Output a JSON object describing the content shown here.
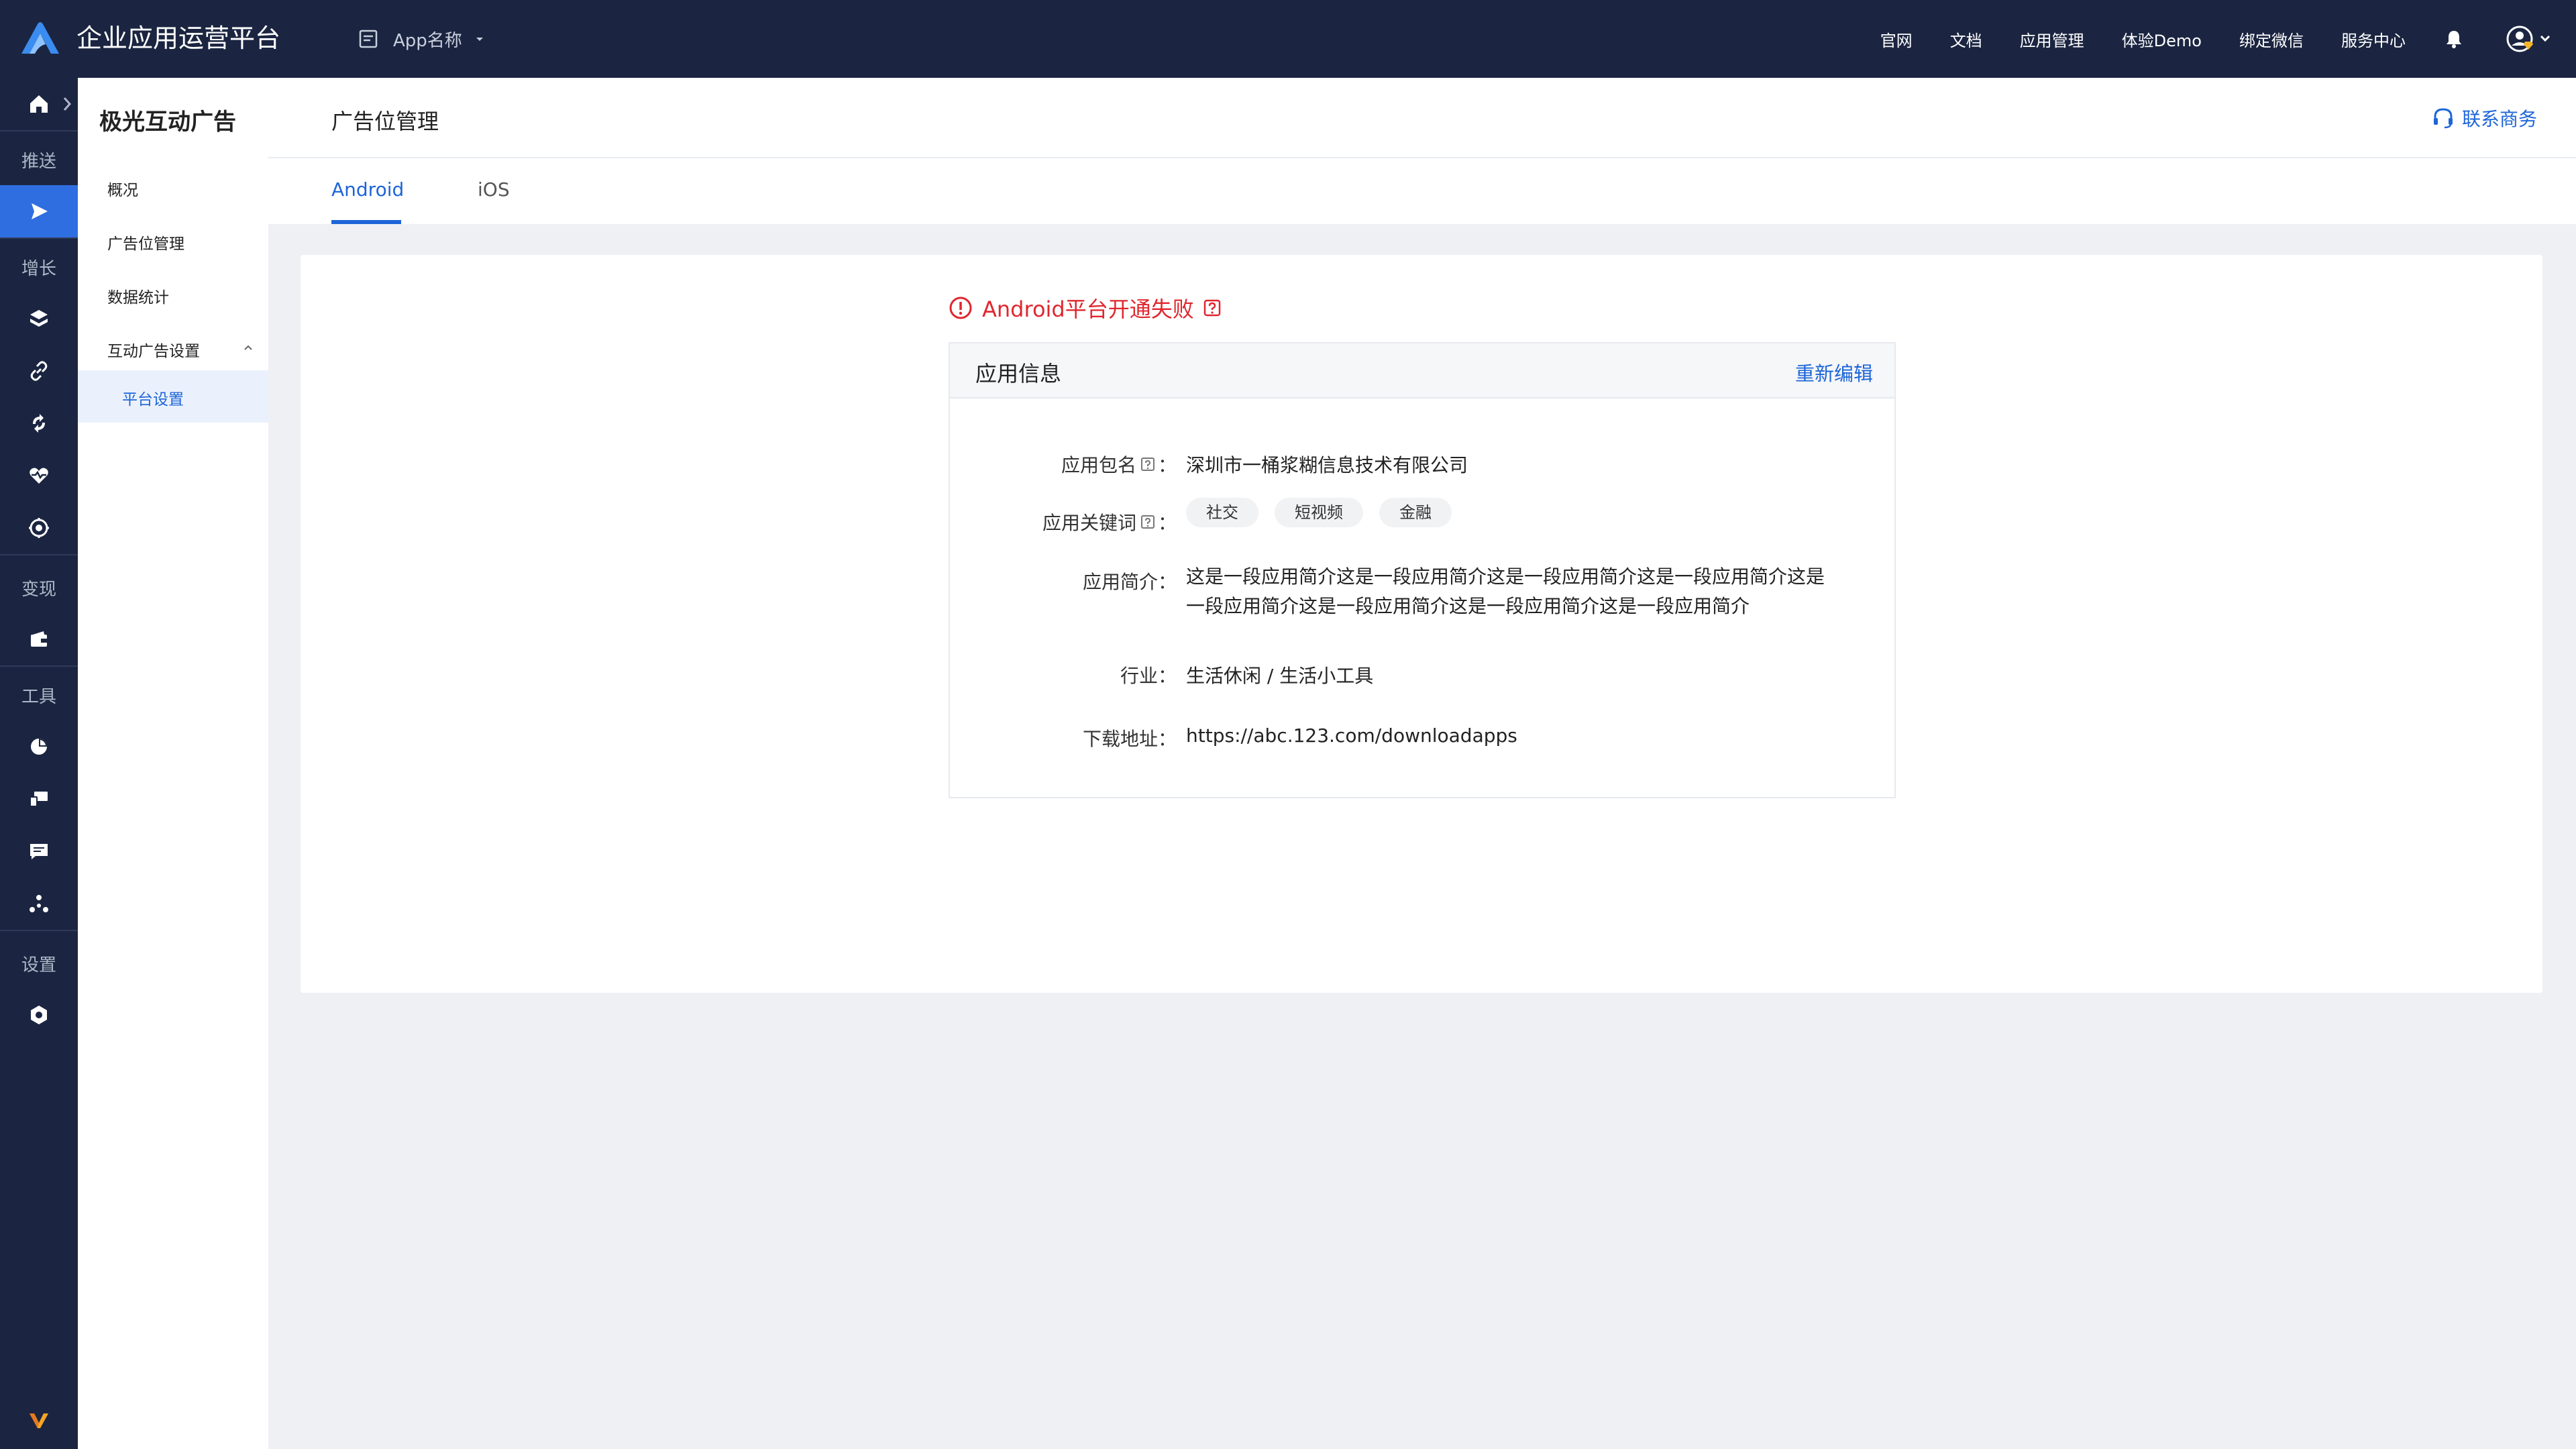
{
  "topbar": {
    "brand": "企业应用运营平台",
    "app_name": "App名称",
    "nav": [
      "官网",
      "文档",
      "应用管理",
      "体验Demo",
      "绑定微信",
      "服务中心"
    ]
  },
  "rail": {
    "sections": [
      "推送",
      "增长",
      "变现",
      "工具",
      "设置"
    ]
  },
  "sidebar": {
    "title": "极光互动广告",
    "items": [
      "概况",
      "广告位管理",
      "数据统计",
      "互动广告设置"
    ],
    "sub_item": "平台设置"
  },
  "header": {
    "title": "广告位管理",
    "contact": "联系商务"
  },
  "tabs": [
    "Android",
    "iOS"
  ],
  "status": {
    "text": "Android平台开通失败",
    "color": "#e0262e"
  },
  "app_info": {
    "title": "应用信息",
    "edit": "重新编辑",
    "labels": {
      "package": "应用包名",
      "keywords": "应用关键词",
      "intro": "应用简介：",
      "industry": "行业：",
      "download": "下载地址："
    },
    "colon": "：",
    "package_name": "深圳市一桶浆糊信息技术有限公司",
    "keywords": [
      "社交",
      "短视频",
      "金融"
    ],
    "intro_line1": "这是一段应用简介这是一段应用简介这是一段应用简介这是一段应用简介这是",
    "intro_line2": "一段应用简介这是一段应用简介这是一段应用简介这是一段应用简介",
    "industry": "生活休闲 / 生活小工具",
    "download_url": "https://abc.123.com/downloadapps"
  },
  "colors": {
    "accent": "#1d65d8",
    "navbar": "#1b2541"
  }
}
